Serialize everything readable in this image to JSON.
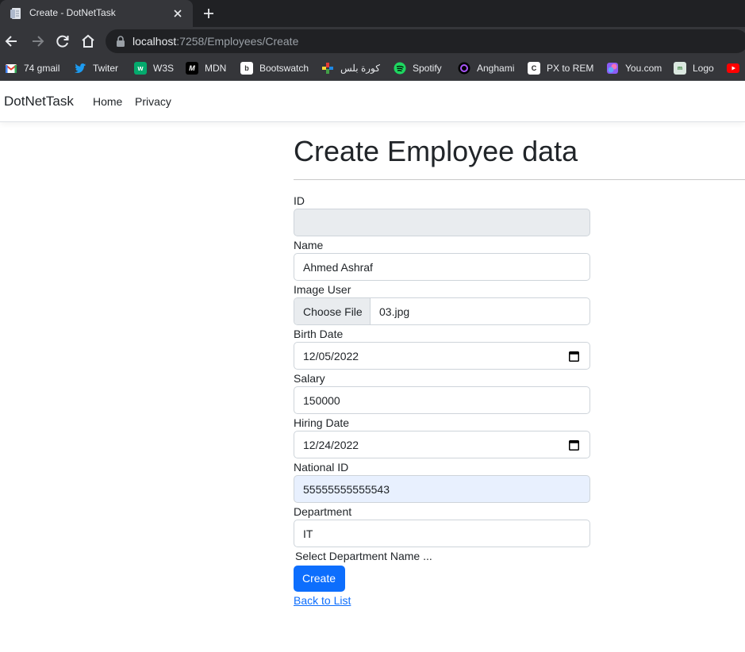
{
  "browser": {
    "tab_title": "Create - DotNetTask",
    "url_host": "localhost",
    "url_path": ":7258/Employees/Create",
    "bookmarks": [
      {
        "label": "74 gmail",
        "icon": "gmail-icon"
      },
      {
        "label": "Twiter",
        "icon": "twitter-icon"
      },
      {
        "label": "W3S",
        "icon": "w3schools-icon"
      },
      {
        "label": "MDN",
        "icon": "mdn-icon"
      },
      {
        "label": "Bootswatch",
        "icon": "bootswatch-icon"
      },
      {
        "label": "كورة بلس",
        "icon": "kooraplus-icon"
      },
      {
        "label": "Spotify",
        "icon": "spotify-icon"
      },
      {
        "label": "Anghami",
        "icon": "anghami-icon"
      },
      {
        "label": "PX to REM",
        "icon": "px-to-rem-icon"
      },
      {
        "label": "You.com",
        "icon": "youcom-icon"
      },
      {
        "label": "Logo",
        "icon": "logo-icon"
      }
    ]
  },
  "navbar": {
    "brand": "DotNetTask",
    "links": [
      "Home",
      "Privacy"
    ]
  },
  "form": {
    "heading": "Create Employee data",
    "id_label": "ID",
    "id_value": "",
    "name_label": "Name",
    "name_value": "Ahmed Ashraf",
    "image_label": "Image User",
    "choose_file_label": "Choose File",
    "image_file": "03.jpg",
    "birth_label": "Birth Date",
    "birth_value": "12/05/2022",
    "salary_label": "Salary",
    "salary_value": "150000",
    "hiring_label": "Hiring Date",
    "hiring_value": "12/24/2022",
    "national_label": "National ID",
    "national_value": "55555555555543",
    "department_label": "Department",
    "department_value": "IT",
    "department_hint": "Select Department Name ...",
    "submit_label": "Create",
    "back_link": "Back to List"
  },
  "colors": {
    "chrome_dark": "#202124",
    "chrome_tab": "#35363a",
    "primary": "#0d6efd",
    "disabled_input": "#e9ecef",
    "autofill_input": "#e8f0fe"
  }
}
